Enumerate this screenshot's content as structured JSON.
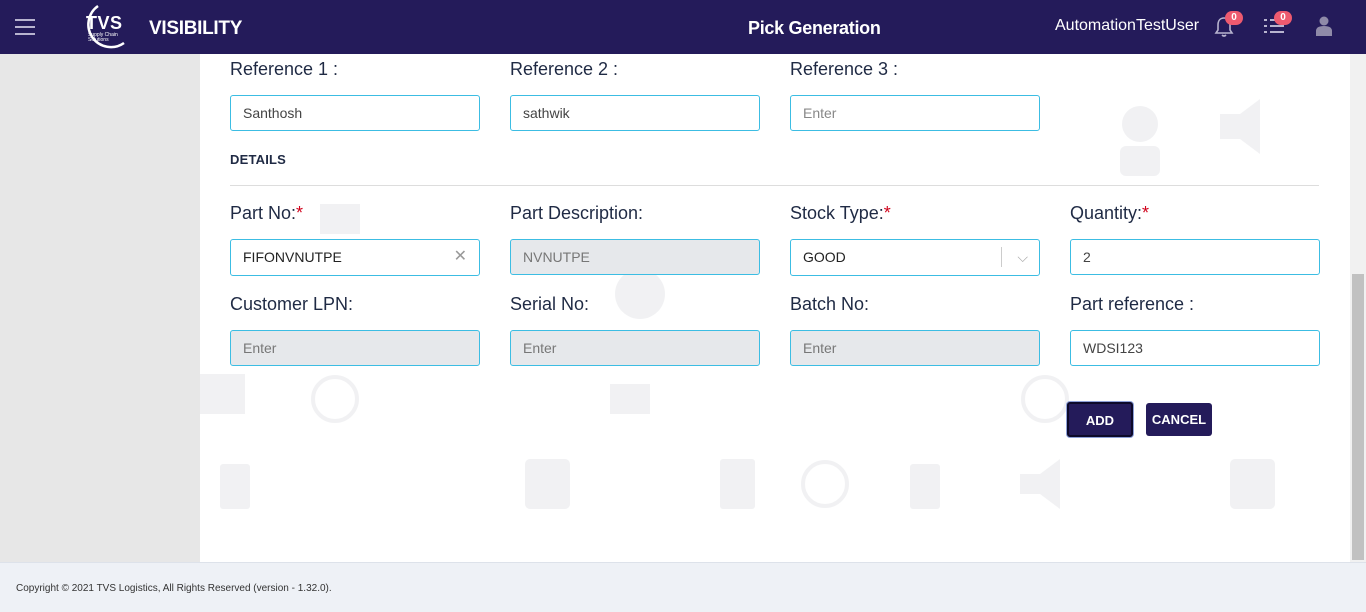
{
  "header": {
    "logo_text": "TVS",
    "logo_sub": "Supply Chain Solutions",
    "brand": "VISIBILITY",
    "page_title": "Pick Generation",
    "user": "AutomationTestUser",
    "notifications_count": "0",
    "tasks_count": "0"
  },
  "form": {
    "ref1_label": "Reference 1 :",
    "ref1_value": "Santhosh",
    "ref2_label": "Reference 2 :",
    "ref2_value": "sathwik",
    "ref3_label": "Reference 3 :",
    "ref3_placeholder": "Enter",
    "section_title": "DETAILS",
    "part_no_label": "Part No:",
    "part_no_value": "FIFONVNUTPE",
    "part_desc_label": "Part Description:",
    "part_desc_value": "NVNUTPE",
    "stock_type_label": "Stock Type:",
    "stock_type_value": "GOOD",
    "quantity_label": "Quantity:",
    "quantity_value": "2",
    "customer_lpn_label": "Customer LPN:",
    "customer_lpn_placeholder": "Enter",
    "serial_no_label": "Serial No:",
    "serial_no_placeholder": "Enter",
    "batch_no_label": "Batch No:",
    "batch_no_placeholder": "Enter",
    "part_ref_label": "Part reference :",
    "part_ref_value": "WDSI123",
    "required_mark": "*"
  },
  "buttons": {
    "add": "ADD",
    "cancel": "CANCEL"
  },
  "footer": {
    "copyright": "Copyright © 2021 TVS Logistics, All Rights Reserved (version - 1.32.0)."
  },
  "colors": {
    "header_bg": "#241b5a",
    "field_border": "#3cbde3",
    "required": "#d0021b",
    "badge": "#ee5a6f"
  }
}
